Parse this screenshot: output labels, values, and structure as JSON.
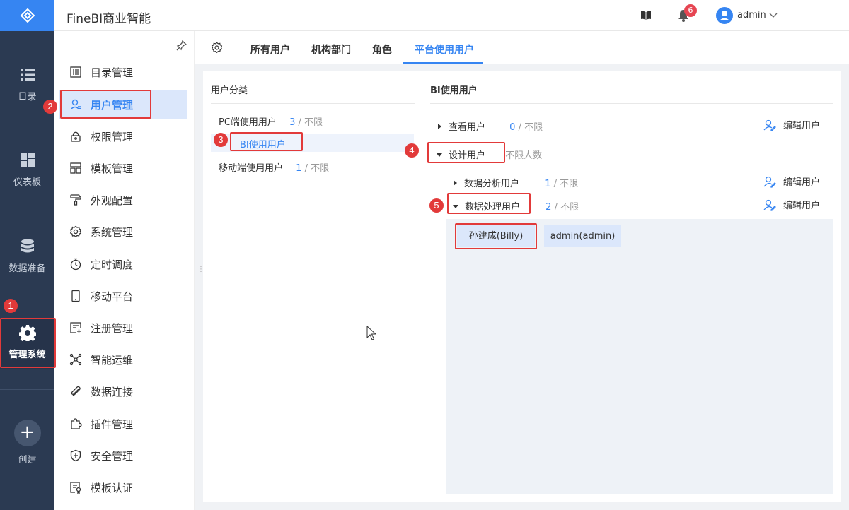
{
  "app": {
    "title": "FineBI商业智能"
  },
  "header": {
    "notification_count": "6",
    "user": "admin"
  },
  "rail": {
    "items": [
      {
        "label": "目录"
      },
      {
        "label": "仪表板"
      },
      {
        "label": "数据准备"
      },
      {
        "label": "管理系统"
      },
      {
        "label": "创建"
      }
    ]
  },
  "submenu": {
    "items": [
      {
        "label": "目录管理"
      },
      {
        "label": "用户管理"
      },
      {
        "label": "权限管理"
      },
      {
        "label": "模板管理"
      },
      {
        "label": "外观配置"
      },
      {
        "label": "系统管理"
      },
      {
        "label": "定时调度"
      },
      {
        "label": "移动平台"
      },
      {
        "label": "注册管理"
      },
      {
        "label": "智能运维"
      },
      {
        "label": "数据连接"
      },
      {
        "label": "插件管理"
      },
      {
        "label": "安全管理"
      },
      {
        "label": "模板认证"
      }
    ]
  },
  "tabs": [
    {
      "label": "所有用户"
    },
    {
      "label": "机构部门"
    },
    {
      "label": "角色"
    },
    {
      "label": "平台使用用户"
    }
  ],
  "left_panel": {
    "title": "用户分类",
    "categories": [
      {
        "label": "PC端使用用户",
        "count": "3",
        "limit": " / 不限"
      },
      {
        "label": "BI使用用户"
      },
      {
        "label": "移动端使用用户",
        "count": "1",
        "limit": " / 不限"
      }
    ]
  },
  "right_panel": {
    "title": "BI使用用户",
    "rows": [
      {
        "label": "查看用户",
        "count": "0",
        "limit": " / 不限",
        "edit": "编辑用户"
      },
      {
        "label": "设计用户",
        "note": "不限人数"
      },
      {
        "label": "数据分析用户",
        "count": "1",
        "limit": " / 不限",
        "edit": "编辑用户"
      },
      {
        "label": "数据处理用户",
        "count": "2",
        "limit": " / 不限",
        "edit": "编辑用户"
      }
    ],
    "users": [
      "孙建成(Billy)",
      "admin(admin)"
    ]
  },
  "annotations": [
    "1",
    "2",
    "3",
    "4",
    "5"
  ]
}
